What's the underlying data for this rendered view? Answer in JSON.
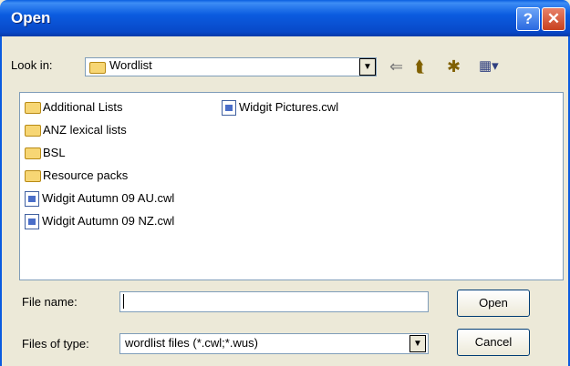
{
  "window": {
    "title": "Open",
    "help_glyph": "?",
    "close_glyph": "✕"
  },
  "lookin": {
    "label": "Look in:",
    "value": "Wordlist"
  },
  "files": [
    {
      "name": "Additional Lists",
      "kind": "folder"
    },
    {
      "name": "ANZ lexical lists",
      "kind": "folder"
    },
    {
      "name": "BSL",
      "kind": "folder"
    },
    {
      "name": "Resource packs",
      "kind": "folder"
    },
    {
      "name": "Widgit Autumn 09 AU.cwl",
      "kind": "file"
    },
    {
      "name": "Widgit Autumn 09 NZ.cwl",
      "kind": "file"
    },
    {
      "name": "Widgit Pictures.cwl",
      "kind": "file"
    }
  ],
  "filename": {
    "label": "File name:",
    "value": ""
  },
  "filetype": {
    "label": "Files of type:",
    "value": "wordlist files (*.cwl;*.wus)"
  },
  "buttons": {
    "open": "Open",
    "cancel": "Cancel"
  },
  "toolbar": {
    "back_glyph": "⇐",
    "up_glyph": "⮬",
    "newfolder_glyph": "✱",
    "views_glyph": "▦▾"
  }
}
